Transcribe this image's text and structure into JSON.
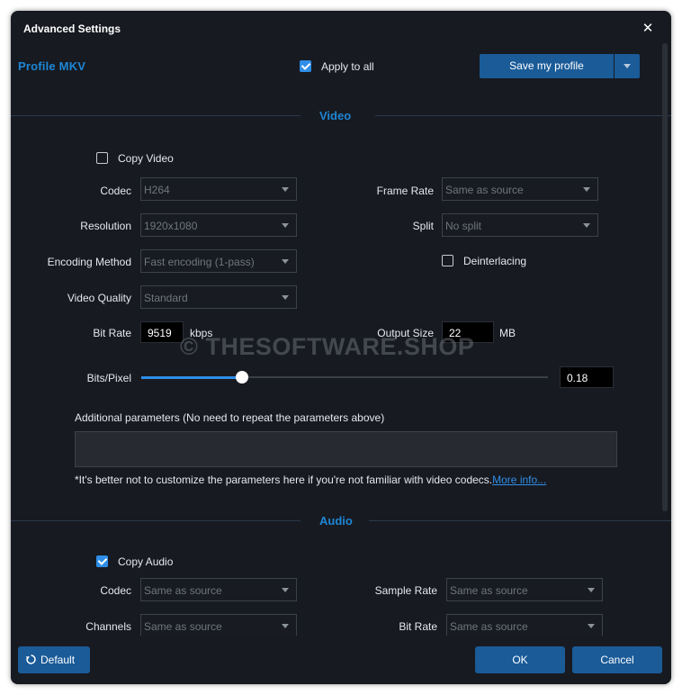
{
  "window": {
    "title": "Advanced Settings",
    "close_glyph": "✕"
  },
  "header": {
    "profile_label": "Profile",
    "profile_value": "MKV",
    "apply_all_label": "Apply to all",
    "apply_all_checked": true,
    "save_profile_label": "Save my profile"
  },
  "video": {
    "section_title": "Video",
    "copy_video_label": "Copy Video",
    "copy_video_checked": false,
    "codec_label": "Codec",
    "codec_value": "H264",
    "resolution_label": "Resolution",
    "resolution_value": "1920x1080",
    "encoding_label": "Encoding Method",
    "encoding_value": "Fast encoding (1-pass)",
    "quality_label": "Video Quality",
    "quality_value": "Standard",
    "bitrate_label": "Bit Rate",
    "bitrate_value": "9519",
    "bitrate_unit": "kbps",
    "framerate_label": "Frame Rate",
    "framerate_value": "Same as source",
    "split_label": "Split",
    "split_value": "No split",
    "deinterlacing_label": "Deinterlacing",
    "deinterlacing_checked": false,
    "output_size_label": "Output Size",
    "output_size_value": "22",
    "output_size_unit": "MB",
    "bits_pixel_label": "Bits/Pixel",
    "bits_pixel_value": "0.18",
    "bits_pixel_slider_fraction": 0.25,
    "additional_params_label": "Additional parameters (No need to repeat the parameters above)",
    "additional_params_value": "",
    "note_text": "*It's better not to customize the parameters here if you're not familiar with video codecs.",
    "more_info_link": "More info..."
  },
  "audio": {
    "section_title": "Audio",
    "copy_audio_label": "Copy Audio",
    "copy_audio_checked": true,
    "codec_label": "Codec",
    "codec_value": "Same as source",
    "channels_label": "Channels",
    "channels_value": "Same as source",
    "samplerate_label": "Sample Rate",
    "samplerate_value": "Same as source",
    "bitrate_label": "Bit Rate",
    "bitrate_value": "Same as source"
  },
  "footer": {
    "default_label": "Default",
    "default_icon": "reset-icon",
    "ok_label": "OK",
    "cancel_label": "Cancel"
  },
  "watermark": "© THESOFTWARE.SHOP",
  "colors": {
    "accent": "#1d87d6",
    "button": "#1a5b98",
    "background": "#171a21"
  }
}
